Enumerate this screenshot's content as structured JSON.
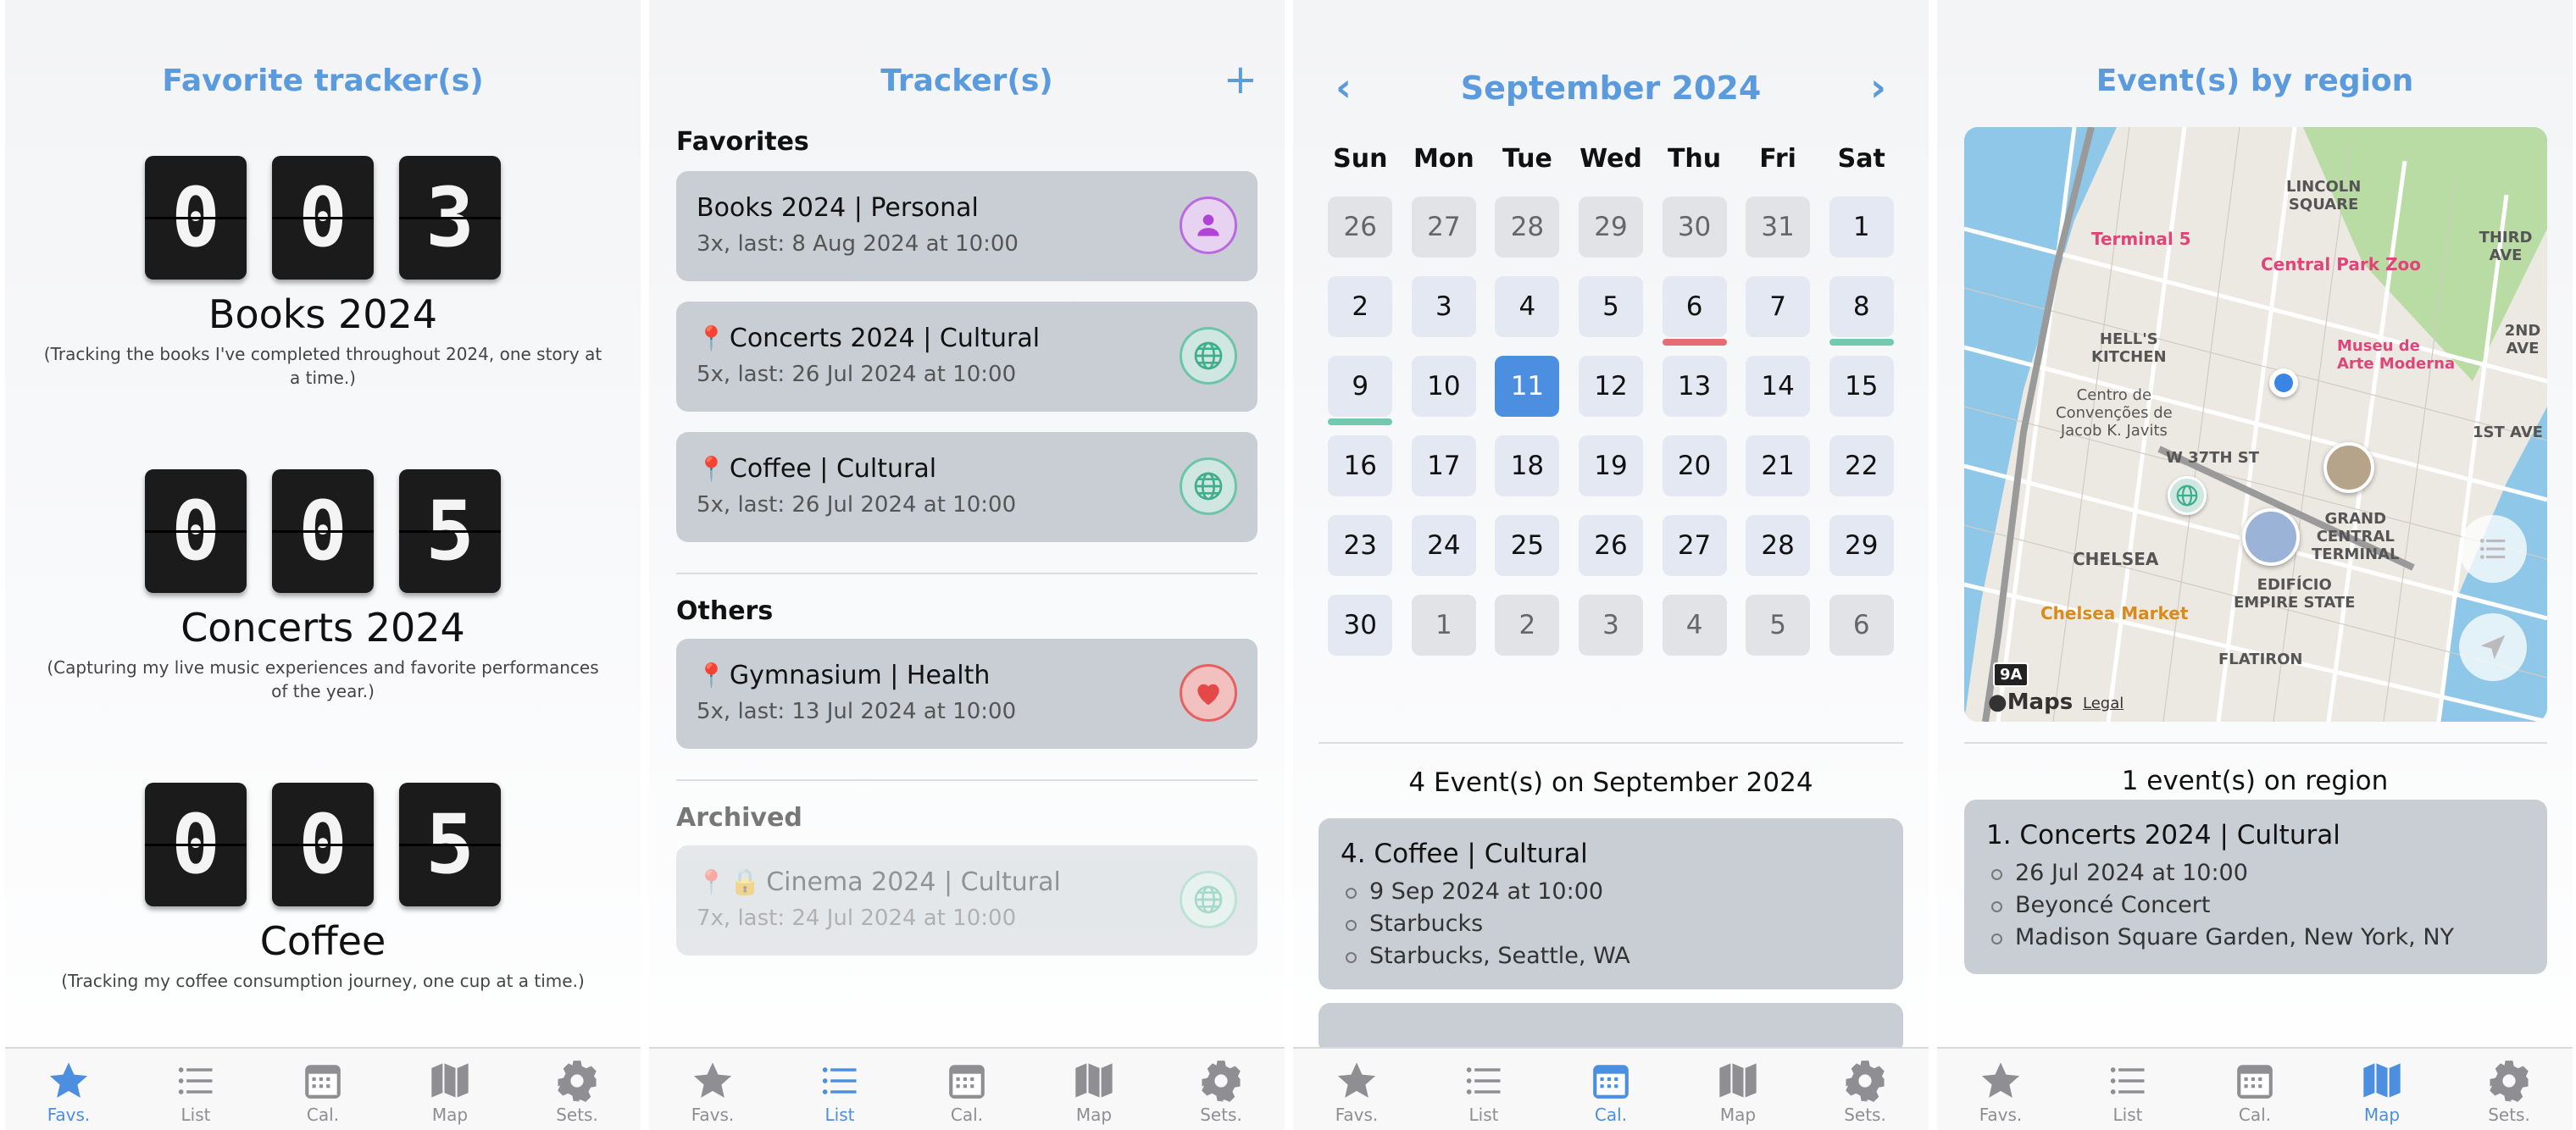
{
  "favs": {
    "title": "Favorite tracker(s)",
    "items": [
      {
        "digits": [
          "0",
          "0",
          "3"
        ],
        "name": "Books 2024",
        "desc": "(Tracking the books I've completed throughout 2024, one story at a time.)"
      },
      {
        "digits": [
          "0",
          "0",
          "5"
        ],
        "name": "Concerts 2024",
        "desc": "(Capturing my live music experiences and favorite performances of the year.)"
      },
      {
        "digits": [
          "0",
          "0",
          "5"
        ],
        "name": "Coffee",
        "desc": "(Tracking my coffee consumption journey, one cup at a time.)"
      }
    ]
  },
  "list": {
    "title": "Tracker(s)",
    "add_icon": "+",
    "favorites_label": "Favorites",
    "others_label": "Others",
    "archived_label": "Archived",
    "favorites": [
      {
        "title": "Books 2024 | Personal",
        "sub": "3x, last: 8 Aug 2024 at 10:00",
        "icon": "person-icon",
        "pin": false
      },
      {
        "title": "Concerts 2024 | Cultural",
        "sub": "5x, last: 26 Jul 2024 at 10:00",
        "icon": "globe-icon",
        "pin": true
      },
      {
        "title": "Coffee | Cultural",
        "sub": "5x, last: 26 Jul 2024 at 10:00",
        "icon": "globe-icon",
        "pin": true
      }
    ],
    "others": [
      {
        "title": "Gymnasium | Health",
        "sub": "5x, last: 13 Jul 2024 at 10:00",
        "icon": "heart-icon",
        "pin": true
      }
    ],
    "archived": [
      {
        "title": "Cinema 2024 | Cultural",
        "sub": "7x, last: 24 Jul 2024 at 10:00",
        "icon": "globe-icon",
        "pin": true,
        "lock": true
      }
    ]
  },
  "cal": {
    "month": "September 2024",
    "prev": "‹",
    "next": "›",
    "weekdays": [
      "Sun",
      "Mon",
      "Tue",
      "Wed",
      "Thu",
      "Fri",
      "Sat"
    ],
    "days": [
      [
        "26",
        "other",
        ""
      ],
      [
        "27",
        "other",
        ""
      ],
      [
        "28",
        "other",
        ""
      ],
      [
        "29",
        "other",
        ""
      ],
      [
        "30",
        "other",
        ""
      ],
      [
        "31",
        "other",
        ""
      ],
      [
        "1",
        "cur",
        ""
      ],
      [
        "2",
        "cur",
        ""
      ],
      [
        "3",
        "cur",
        ""
      ],
      [
        "4",
        "cur",
        ""
      ],
      [
        "5",
        "cur",
        ""
      ],
      [
        "6",
        "cur",
        "#e66b72"
      ],
      [
        "7",
        "cur",
        ""
      ],
      [
        "8",
        "cur",
        "#72c9ad"
      ],
      [
        "9",
        "cur",
        "#72c9ad"
      ],
      [
        "10",
        "cur",
        ""
      ],
      [
        "11",
        "today",
        ""
      ],
      [
        "12",
        "cur",
        ""
      ],
      [
        "13",
        "cur",
        ""
      ],
      [
        "14",
        "cur",
        ""
      ],
      [
        "15",
        "cur",
        ""
      ],
      [
        "16",
        "cur",
        ""
      ],
      [
        "17",
        "cur",
        ""
      ],
      [
        "18",
        "cur",
        ""
      ],
      [
        "19",
        "cur",
        ""
      ],
      [
        "20",
        "cur",
        ""
      ],
      [
        "21",
        "cur",
        ""
      ],
      [
        "22",
        "cur",
        ""
      ],
      [
        "23",
        "cur",
        ""
      ],
      [
        "24",
        "cur",
        ""
      ],
      [
        "25",
        "cur",
        ""
      ],
      [
        "26",
        "cur",
        ""
      ],
      [
        "27",
        "cur",
        ""
      ],
      [
        "28",
        "cur",
        ""
      ],
      [
        "29",
        "cur",
        ""
      ],
      [
        "30",
        "cur",
        ""
      ],
      [
        "1",
        "other",
        ""
      ],
      [
        "2",
        "other",
        ""
      ],
      [
        "3",
        "other",
        ""
      ],
      [
        "4",
        "other",
        ""
      ],
      [
        "5",
        "other",
        ""
      ],
      [
        "6",
        "other",
        ""
      ]
    ],
    "events_title": "4 Event(s) on September 2024",
    "event": {
      "title": "4. Coffee | Cultural",
      "lines": [
        "9 Sep 2024 at 10:00",
        "Starbucks",
        "Starbucks, Seattle, WA"
      ]
    }
  },
  "map": {
    "title": "Event(s) by region",
    "labels": {
      "lincoln": "LINCOLN\nSQUARE",
      "terminal5": "Terminal 5",
      "zoo": "Central Park Zoo",
      "hells": "HELL'S\nKITCHEN",
      "moma": "Museu de\nArte Moderna",
      "javits": "Centro de\nConvenções de\nJacob K. Javits",
      "w37": "W 37TH ST",
      "grand": "GRAND\nCENTRAL\nTERMINAL",
      "chelsea": "CHELSEA",
      "empire": "EDIFÍCIO\nEMPIRE STATE",
      "market": "Chelsea Market",
      "flatiron": "FLATIRON",
      "third": "THIRD AVE",
      "second": "2ND AVE",
      "first": "1ST AVE",
      "hwy": "9A",
      "maps": "Maps",
      "legal": "Legal"
    },
    "events_title": "1 event(s) on region",
    "event": {
      "title": "1. Concerts 2024 | Cultural",
      "lines": [
        "26 Jul 2024 at 10:00",
        "Beyoncé Concert",
        "Madison Square Garden, New York, NY"
      ]
    }
  },
  "tabs": [
    "Favs.",
    "List",
    "Cal.",
    "Map",
    "Sets."
  ],
  "accent": "#4c8ee0"
}
